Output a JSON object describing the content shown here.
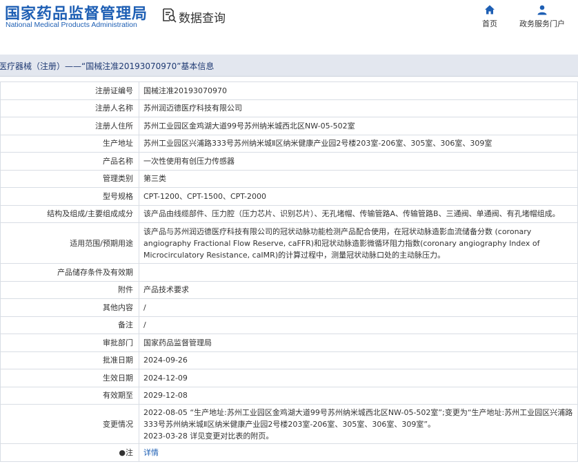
{
  "header": {
    "logo_cn": "国家药品监督管理局",
    "logo_en": "National Medical Products Administration",
    "search_title": "数据查询",
    "nav": {
      "home": "首页",
      "portal": "政务服务门户"
    }
  },
  "title_bar": "医疗器械（注册）——“国械注准20193070970”基本信息",
  "rows": [
    {
      "label": "注册证编号",
      "value": "国械注准20193070970"
    },
    {
      "label": "注册人名称",
      "value": "苏州润迈德医疗科技有限公司"
    },
    {
      "label": "注册人住所",
      "value": "苏州工业园区金鸡湖大道99号苏州纳米城西北区NW-05-502室"
    },
    {
      "label": "生产地址",
      "value": "苏州工业园区兴浦路333号苏州纳米城Ⅱ区纳米健康产业园2号楼203室-206室、305室、306室、309室"
    },
    {
      "label": "产品名称",
      "value": "一次性使用有创压力传感器"
    },
    {
      "label": "管理类别",
      "value": "第三类"
    },
    {
      "label": "型号规格",
      "value": "CPT-1200、CPT-1500、CPT-2000"
    },
    {
      "label": "结构及组成/主要组成成分",
      "value": "该产品由线缆部件、压力腔（压力芯片、识别芯片）、无孔堵帽、传输管路A、传输管路B、三通阀、单通阀、有孔堵帽组成。"
    },
    {
      "label": "适用范围/预期用途",
      "value": "该产品与苏州润迈德医疗科技有限公司的冠状动脉功能检测产品配合使用，在冠状动脉造影血流储备分数 (coronary angiography Fractional Flow Reserve, caFFR)和冠状动脉造影微循环阻力指数(coronary angiography Index of Microcirculatory Resistance, caIMR)的计算过程中，测量冠状动脉口处的主动脉压力。"
    },
    {
      "label": "产品储存条件及有效期",
      "value": ""
    },
    {
      "label": "附件",
      "value": "产品技术要求"
    },
    {
      "label": "其他内容",
      "value": "/"
    },
    {
      "label": "备注",
      "value": "/"
    },
    {
      "label": "审批部门",
      "value": "国家药品监督管理局"
    },
    {
      "label": "批准日期",
      "value": "2024-09-26"
    },
    {
      "label": "生效日期",
      "value": "2024-12-09"
    },
    {
      "label": "有效期至",
      "value": "2029-12-08"
    },
    {
      "label": "变更情况",
      "value_lines": [
        "2022-08-05 “生产地址:苏州工业园区金鸡湖大道99号苏州纳米城西北区NW-05-502室”;变更为“生产地址:苏州工业园区兴浦路333号苏州纳米城Ⅱ区纳米健康产业园2号楼203室-206室、305室、306室、309室”。",
        "2023-03-28 详见变更对比表的附页。"
      ]
    },
    {
      "label": "●注",
      "value": "详情"
    }
  ]
}
